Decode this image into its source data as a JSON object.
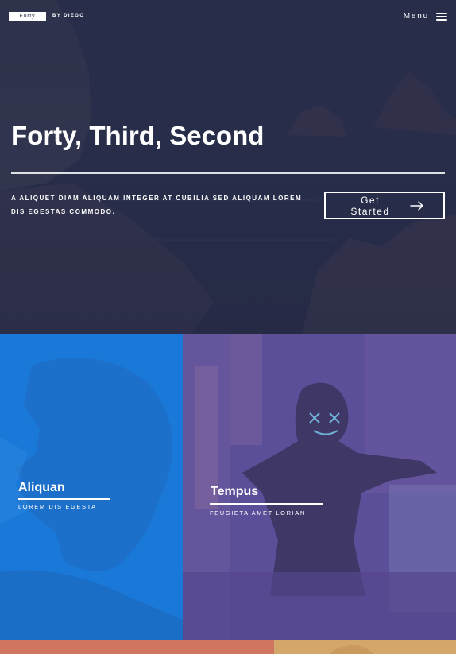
{
  "header": {
    "logo_text": "Forty",
    "logo_byline": "BY DIEGO",
    "menu_label": "Menu",
    "menu_icon": "hamburger-icon"
  },
  "banner": {
    "title": "Forty, Third, Second",
    "description": "A aliquet diam aliquam integer at cubilia sed aliquam lorem dis egestas commodo.",
    "cta_label": "Get Started",
    "cta_icon": "arrow-right-icon"
  },
  "tiles": [
    {
      "title": "Aliquan",
      "subtitle": "Lorem dis egesta",
      "tint": "#1a78d9"
    },
    {
      "title": "Tempus",
      "subtitle": "Feugieta amet lorian",
      "tint": "#5a4f98"
    }
  ],
  "next_tiles": [
    {
      "tint": "#d0755f"
    },
    {
      "tint": "#d3a66a"
    }
  ],
  "colors": {
    "background": "#242943",
    "text": "#ffffff"
  }
}
